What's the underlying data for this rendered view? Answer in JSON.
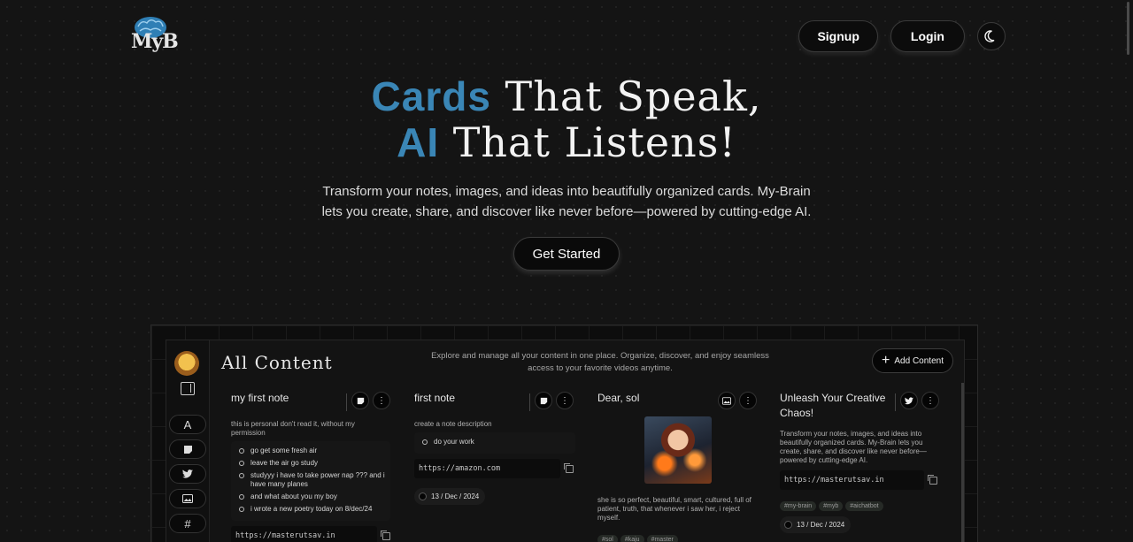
{
  "logo": {
    "text": "MyB"
  },
  "nav": {
    "signup": "Signup",
    "login": "Login",
    "theme_icon": "moon-icon"
  },
  "hero": {
    "line1_accent": "Cards",
    "line1_rest": " That Speak,",
    "line2_accent": "AI",
    "line2_rest": " That Listens!",
    "description": "Transform your notes, images, and ideas into beautifully organized cards. My-Brain lets you create, share, and discover like never before—powered by cutting-edge AI.",
    "cta": "Get Started"
  },
  "app": {
    "title": "All Content",
    "description": "Explore and manage all your content in one place. Organize, discover, and enjoy seamless access to your favorite videos anytime.",
    "add_button": "Add Content",
    "sidebar": [
      {
        "label": "A",
        "icon": "all-icon"
      },
      {
        "label": "",
        "icon": "note-icon"
      },
      {
        "label": "",
        "icon": "twitter-icon"
      },
      {
        "label": "",
        "icon": "image-icon"
      },
      {
        "label": "#",
        "icon": "hashtag-icon"
      }
    ],
    "cards": [
      {
        "title": "my first note",
        "description": "this is personal don't read it, without my permission",
        "items": [
          "go get some fresh air",
          "leave the air go study",
          "studyyy i have to take power nap ??? and i have many planes",
          "and what about you my boy",
          "i wrote a new poetry today on 8/dec/24"
        ],
        "link": "https://masterutsav.in"
      },
      {
        "title": "first note",
        "description": "create a note description",
        "items": [
          "do your work"
        ],
        "link": "https://amazon.com",
        "date": "13 / Dec / 2024"
      },
      {
        "title": "Dear, sol",
        "description": "she is so perfect, beautiful, smart, cultured, full of patient, truth, that whenever i saw her, i reject myself.",
        "tags": [
          "#sol",
          "#kaju",
          "#master"
        ]
      },
      {
        "title": "Unleash Your Creative Chaos!",
        "description": "Transform your notes, images, and ideas into beautifully organized cards. My-Brain lets you create, share, and discover like never before—powered by cutting-edge AI.",
        "link": "https://masterutsav.in",
        "tags": [
          "#my-brain",
          "#myb",
          "#aichatbot"
        ],
        "date": "13 / Dec / 2024"
      }
    ]
  }
}
